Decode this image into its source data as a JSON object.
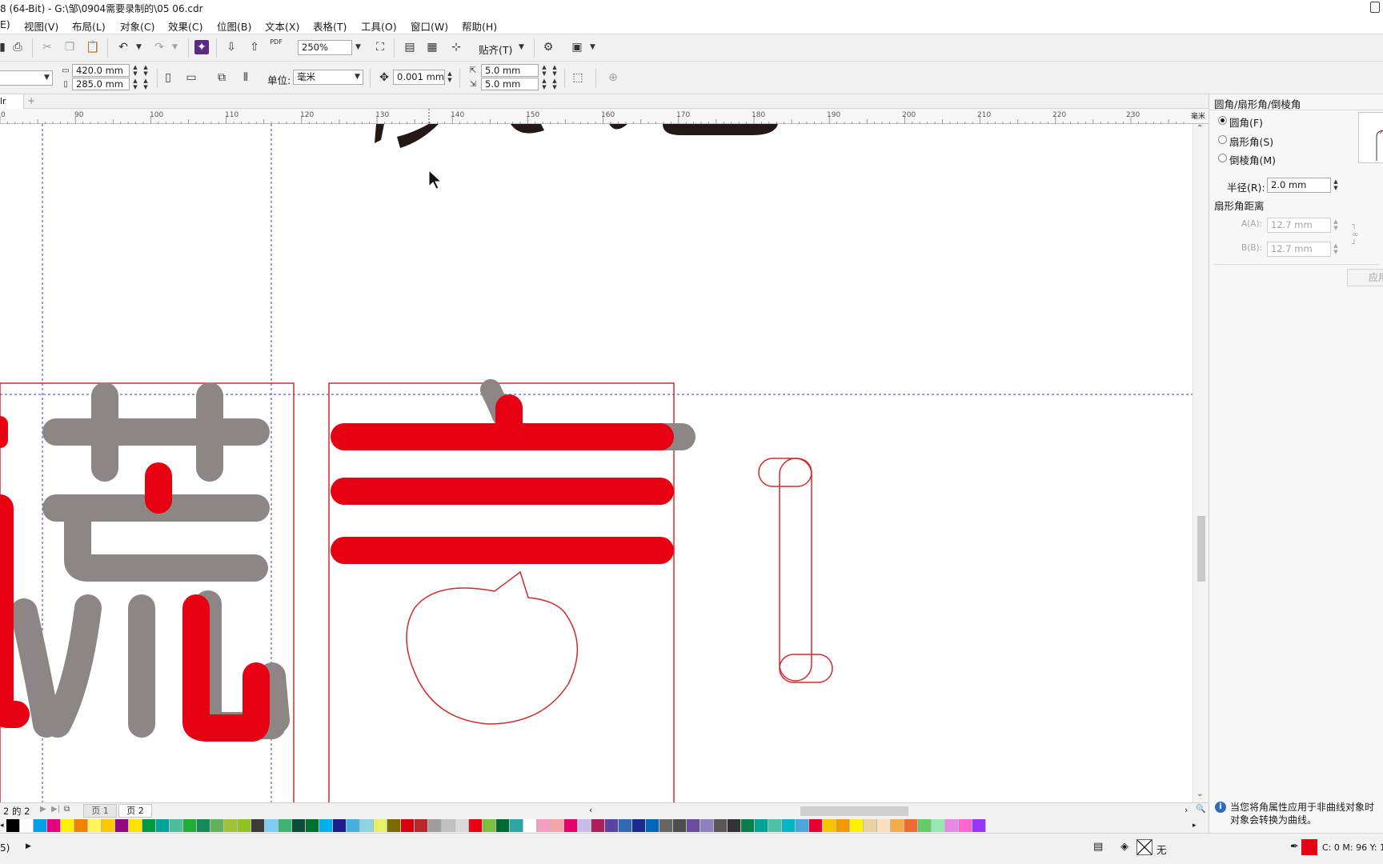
{
  "window": {
    "title": "8 (64-Bit) - G:\\邹\\0904需要录制的\\05 06.cdr"
  },
  "menu": {
    "items": [
      "E)",
      "视图(V)",
      "布局(L)",
      "对象(C)",
      "效果(C)",
      "位图(B)",
      "文本(X)",
      "表格(T)",
      "工具(O)",
      "窗口(W)",
      "帮助(H)"
    ]
  },
  "toolbar": {
    "zoom": "250%",
    "pdf_label": "PDF",
    "snap_label": "贴齐(T)"
  },
  "property_bar": {
    "width": "420.0 mm",
    "height": "285.0 mm",
    "units_label": "单位:",
    "units_value": "毫米",
    "nudge": "0.001 mm",
    "dup_x": "5.0 mm",
    "dup_y": "5.0 mm"
  },
  "document_tab": {
    "name": "lr"
  },
  "ruler": {
    "labels": [
      "0",
      "90",
      "100",
      "110",
      "120",
      "130",
      "140",
      "150",
      "160",
      "170",
      "180",
      "190",
      "200",
      "210",
      "220",
      "230"
    ],
    "unit": "毫米"
  },
  "panel": {
    "title": "圆角/扇形角/倒棱角",
    "options": [
      "圆角(F)",
      "扇形角(S)",
      "倒棱角(M)"
    ],
    "selected_index": 0,
    "radius_label": "半径(R):",
    "radius_value": "2.0 mm",
    "scallop_label": "扇形角距离",
    "a_label": "A(A):",
    "a_value": "12.7 mm",
    "b_label": "B(B):",
    "b_value": "12.7 mm",
    "apply_label": "应用",
    "info_line1": "当您将角属性应用于非曲线对象时",
    "info_line2": "对象会转换为曲线。"
  },
  "pages": {
    "counter": "2 的 2",
    "tabs": [
      "页 1",
      "页 2"
    ],
    "active_index": 1
  },
  "status": {
    "left": "5)",
    "fill_label": "无",
    "color_readout": "C: 0 M: 96 Y: 1"
  },
  "colors": {
    "accent_red": "#e60012",
    "shape_gray": "#8d8685",
    "outline_red": "#d42a2a",
    "guide_blue": "#3a3ac8",
    "palette": [
      "#000000",
      "#ffffff",
      "#00a0e9",
      "#e4007f",
      "#fff100",
      "#f08300",
      "#fff45c",
      "#fcc800",
      "#920783",
      "#ffe100",
      "#009944",
      "#00a29a",
      "#4dbd9a",
      "#22ac38",
      "#178a5a",
      "#5eb35a",
      "#a0c238",
      "#8fc31f",
      "#3e3a39",
      "#7ecef4",
      "#3cb371",
      "#0b4d37",
      "#007130",
      "#00afec",
      "#1d2088",
      "#43b0df",
      "#8ed3e1",
      "#e7ef69",
      "#7a6a00",
      "#d7000f",
      "#b8282c",
      "#9e9e9e",
      "#c0c0c0",
      "#d9d9d9",
      "#e60012",
      "#7fbf3f",
      "#006934",
      "#2ca6a4",
      "#ffffff",
      "#f19ec2",
      "#f3a6a6",
      "#e5006a",
      "#c8bde6",
      "#ae1c5e",
      "#5b45a0",
      "#2f6ab3",
      "#1b2a8c",
      "#0068b7",
      "#666666",
      "#4d4d4d",
      "#6a4c9c",
      "#8f82bc",
      "#595757",
      "#333333",
      "#0b7f4a",
      "#00a497",
      "#4ec1a6",
      "#00b7c3",
      "#4aa6d9",
      "#e60033",
      "#f2c600",
      "#f39800",
      "#fff200",
      "#e8d3a2",
      "#fde0c2",
      "#f6ad49",
      "#ed6d35",
      "#66cc66",
      "#99e6b3",
      "#e68ae6",
      "#ff66cc",
      "#9933ff"
    ]
  }
}
